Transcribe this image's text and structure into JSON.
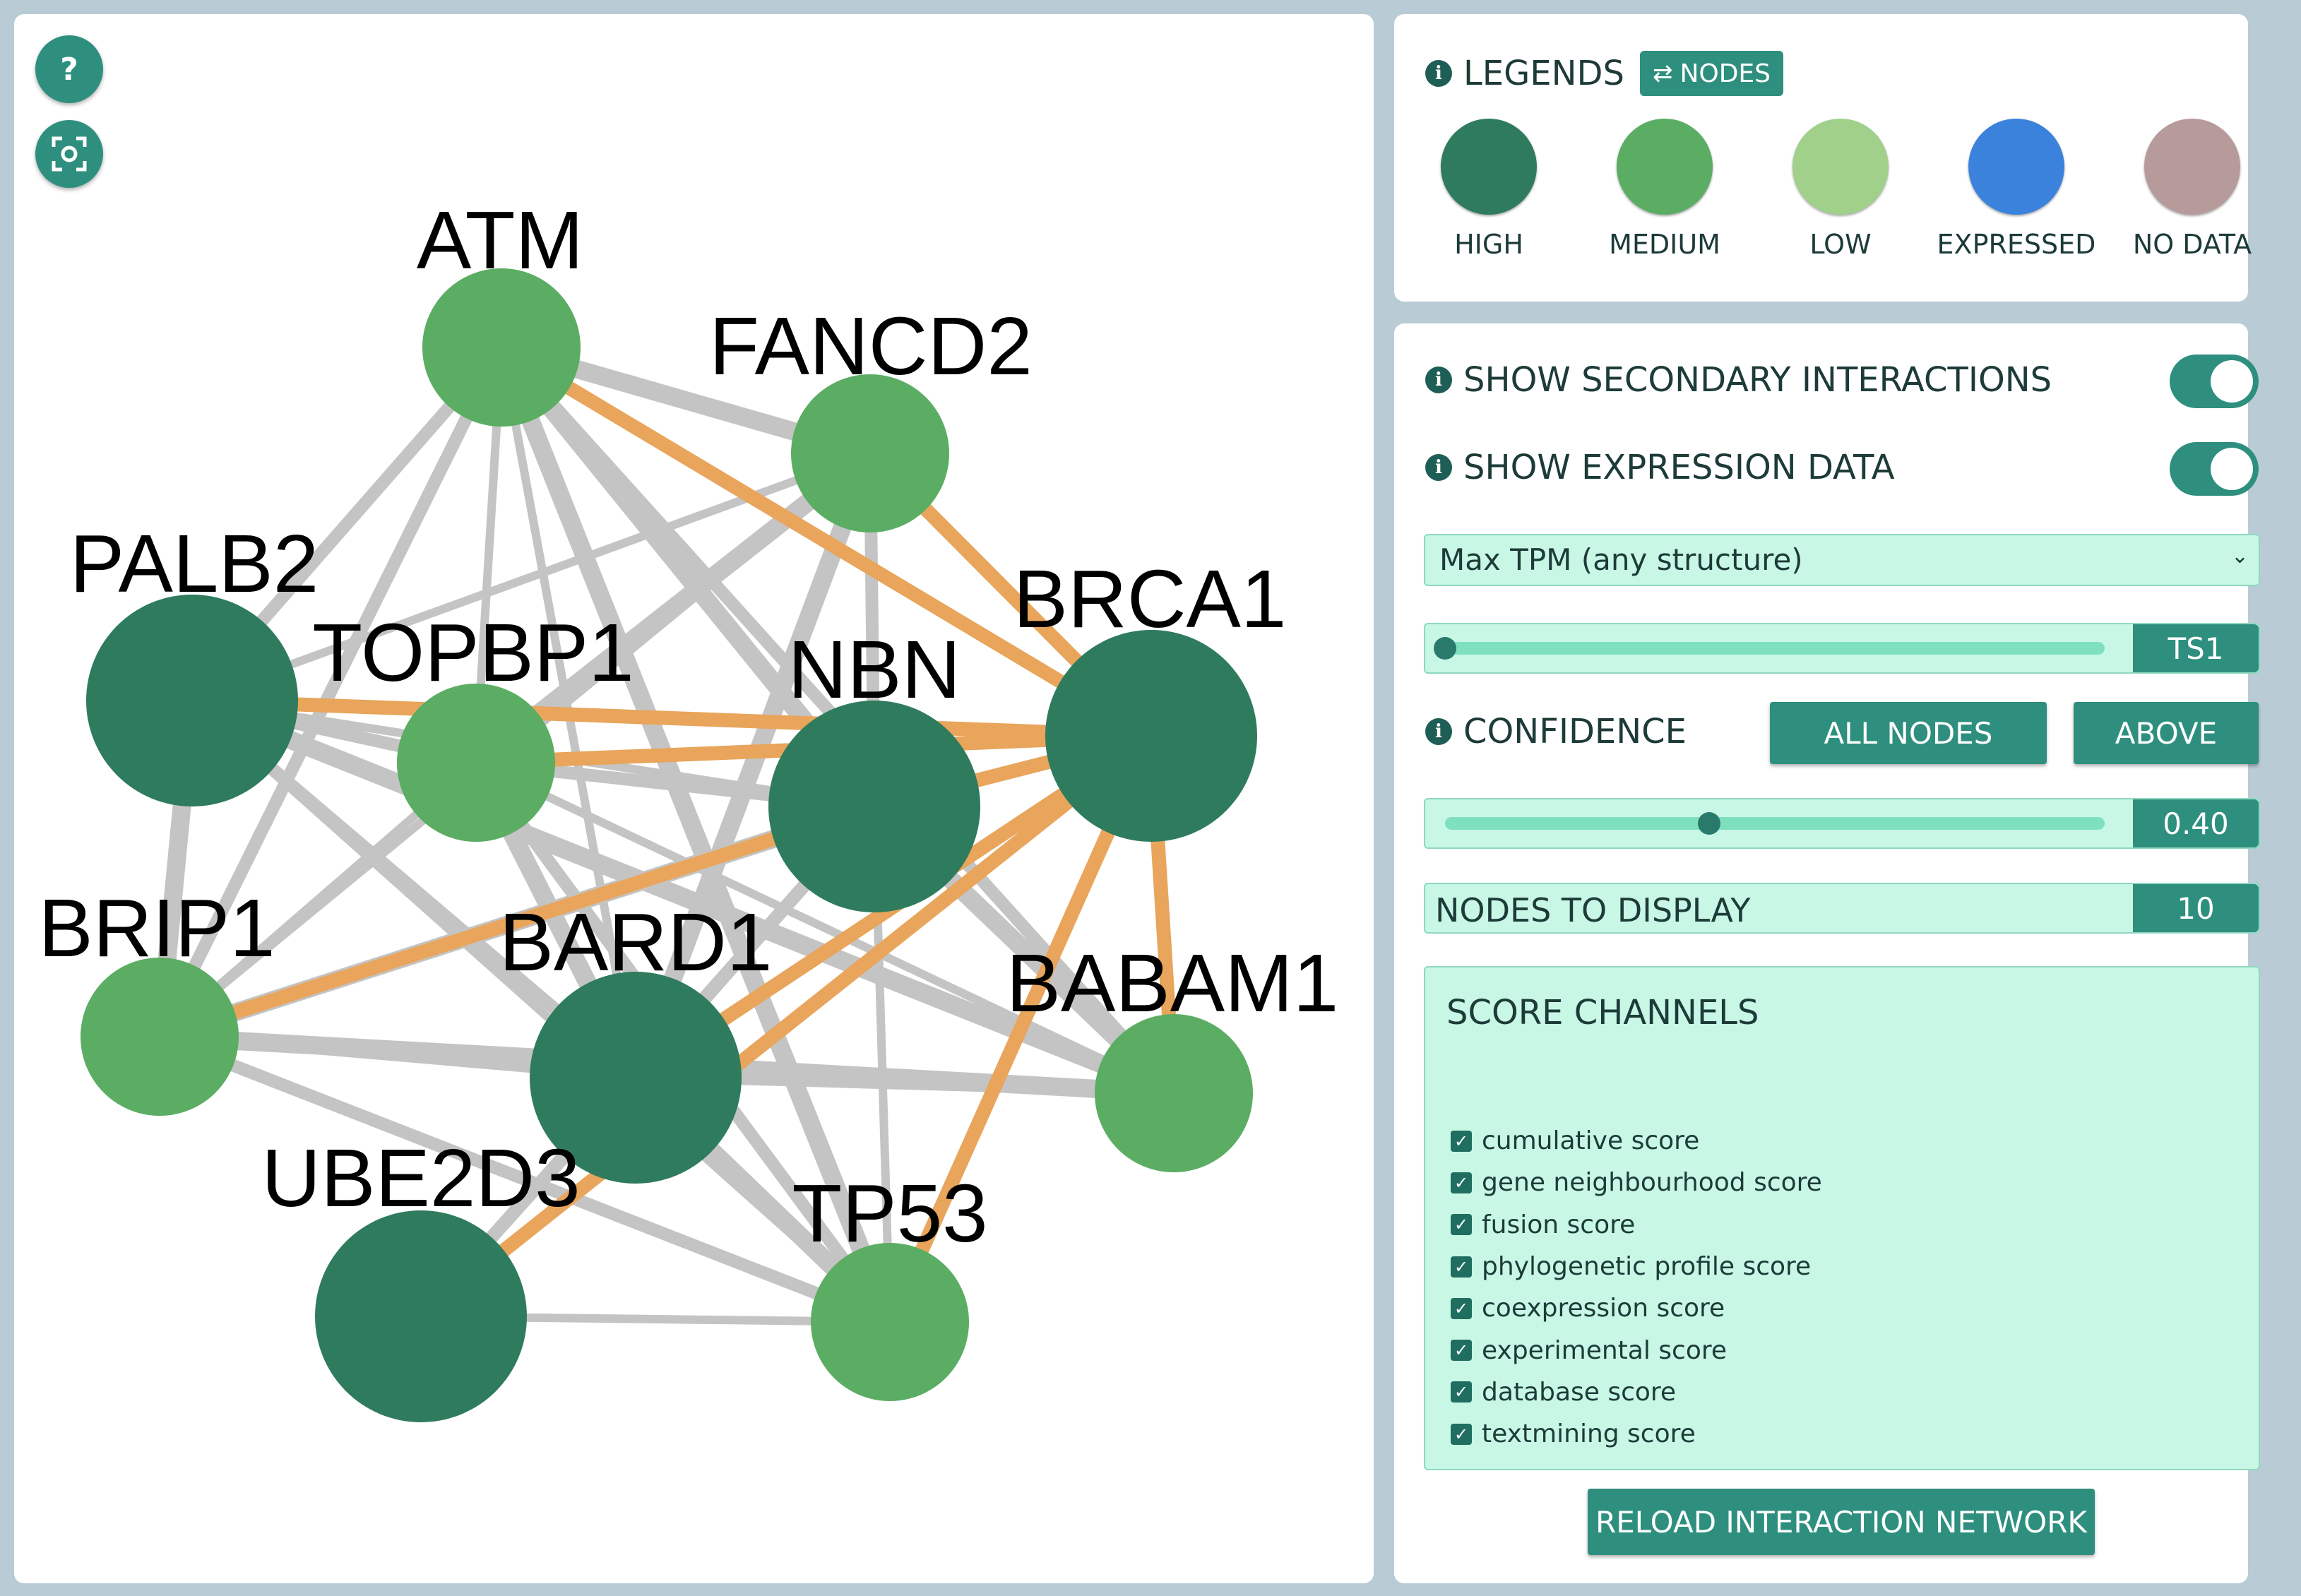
{
  "graph": {
    "help_label": "?",
    "nodes": [
      {
        "label": "ATM",
        "level": "medium"
      },
      {
        "label": "FANCD2",
        "level": "medium"
      },
      {
        "label": "PALB2",
        "level": "high"
      },
      {
        "label": "TOPBP1",
        "level": "medium"
      },
      {
        "label": "NBN",
        "level": "high"
      },
      {
        "label": "BRCA1",
        "level": "high"
      },
      {
        "label": "BRIP1",
        "level": "medium"
      },
      {
        "label": "BARD1",
        "level": "high"
      },
      {
        "label": "BABAM1",
        "level": "medium"
      },
      {
        "label": "UBE2D3",
        "level": "high"
      },
      {
        "label": "TP53",
        "level": "medium"
      }
    ],
    "edges": [
      {
        "source": "ATM",
        "target": "FANCD2",
        "color": "gray"
      },
      {
        "source": "ATM",
        "target": "BRCA1",
        "color": "orange"
      },
      {
        "source": "ATM",
        "target": "PALB2",
        "color": "gray"
      },
      {
        "source": "ATM",
        "target": "TOPBP1",
        "color": "gray"
      },
      {
        "source": "ATM",
        "target": "NBN",
        "color": "gray"
      },
      {
        "source": "ATM",
        "target": "BRIP1",
        "color": "gray"
      },
      {
        "source": "ATM",
        "target": "BARD1",
        "color": "gray"
      },
      {
        "source": "ATM",
        "target": "TP53",
        "color": "gray"
      },
      {
        "source": "ATM",
        "target": "BABAM1",
        "color": "gray"
      },
      {
        "source": "FANCD2",
        "target": "BRCA1",
        "color": "orange"
      },
      {
        "source": "FANCD2",
        "target": "PALB2",
        "color": "gray"
      },
      {
        "source": "FANCD2",
        "target": "TOPBP1",
        "color": "gray"
      },
      {
        "source": "FANCD2",
        "target": "NBN",
        "color": "gray"
      },
      {
        "source": "FANCD2",
        "target": "BRIP1",
        "color": "gray"
      },
      {
        "source": "FANCD2",
        "target": "BARD1",
        "color": "gray"
      },
      {
        "source": "PALB2",
        "target": "BRCA1",
        "color": "orange"
      },
      {
        "source": "PALB2",
        "target": "TOPBP1",
        "color": "gray"
      },
      {
        "source": "PALB2",
        "target": "NBN",
        "color": "gray"
      },
      {
        "source": "PALB2",
        "target": "BRIP1",
        "color": "gray"
      },
      {
        "source": "PALB2",
        "target": "BARD1",
        "color": "gray"
      },
      {
        "source": "PALB2",
        "target": "TP53",
        "color": "gray"
      },
      {
        "source": "PALB2",
        "target": "BABAM1",
        "color": "gray"
      },
      {
        "source": "TOPBP1",
        "target": "BRCA1",
        "color": "orange"
      },
      {
        "source": "TOPBP1",
        "target": "NBN",
        "color": "gray"
      },
      {
        "source": "TOPBP1",
        "target": "BRIP1",
        "color": "gray"
      },
      {
        "source": "TOPBP1",
        "target": "BARD1",
        "color": "gray"
      },
      {
        "source": "TOPBP1",
        "target": "TP53",
        "color": "gray"
      },
      {
        "source": "TOPBP1",
        "target": "BABAM1",
        "color": "gray"
      },
      {
        "source": "NBN",
        "target": "BRCA1",
        "color": "orange"
      },
      {
        "source": "NBN",
        "target": "BRIP1",
        "color": "gray"
      },
      {
        "source": "NBN",
        "target": "BARD1",
        "color": "gray"
      },
      {
        "source": "NBN",
        "target": "TP53",
        "color": "gray"
      },
      {
        "source": "NBN",
        "target": "BABAM1",
        "color": "gray"
      },
      {
        "source": "NBN",
        "target": "UBE2D3",
        "color": "gray"
      },
      {
        "source": "BRCA1",
        "target": "BARD1",
        "color": "orange"
      },
      {
        "source": "BRCA1",
        "target": "BABAM1",
        "color": "orange"
      },
      {
        "source": "BRCA1",
        "target": "TP53",
        "color": "orange"
      },
      {
        "source": "BRCA1",
        "target": "UBE2D3",
        "color": "orange"
      },
      {
        "source": "BRIP1",
        "target": "NBN",
        "color": "orange"
      },
      {
        "source": "BRIP1",
        "target": "BARD1",
        "color": "gray"
      },
      {
        "source": "BRIP1",
        "target": "BABAM1",
        "color": "gray"
      },
      {
        "source": "BRIP1",
        "target": "TP53",
        "color": "gray"
      },
      {
        "source": "BARD1",
        "target": "BABAM1",
        "color": "gray"
      },
      {
        "source": "BARD1",
        "target": "TP53",
        "color": "gray"
      },
      {
        "source": "BARD1",
        "target": "UBE2D3",
        "color": "gray"
      },
      {
        "source": "UBE2D3",
        "target": "TP53",
        "color": "gray"
      }
    ]
  },
  "legend": {
    "title": "LEGENDS",
    "toggle_label": "NODES",
    "items": [
      {
        "label": "HIGH",
        "color": "#2f7b5e"
      },
      {
        "label": "MEDIUM",
        "color": "#5bad63"
      },
      {
        "label": "LOW",
        "color": "#a1d08b"
      },
      {
        "label": "EXPRESSED",
        "color": "#3a82dc"
      },
      {
        "label": "NO DATA",
        "color": "#b79b9b"
      }
    ]
  },
  "controls": {
    "secondary_label": "SHOW SECONDARY INTERACTIONS",
    "secondary_on": true,
    "expression_label": "SHOW EXPRESSION DATA",
    "expression_on": true,
    "tpm_selected": "Max TPM (any structure)",
    "stage_value": "TS1",
    "stage_fraction": 0.0,
    "confidence_label": "CONFIDENCE",
    "all_nodes_label": "ALL NODES",
    "above_label": "ABOVE",
    "confidence_value": "0.40",
    "confidence_fraction": 0.4,
    "nodes_label": "NODES TO DISPLAY",
    "nodes_value": "10",
    "score_title": "SCORE CHANNELS",
    "score_channels": [
      "cumulative score",
      "gene neighbourhood score",
      "fusion score",
      "phylogenetic profile score",
      "coexpression score",
      "experimental score",
      "database score",
      "textmining score"
    ],
    "reload_label": "RELOAD INTERACTION NETWORK"
  },
  "colors": {
    "accent": "#2e8f7e",
    "mint": "#c8f7e6",
    "edge_gray": "#c4c4c4",
    "edge_orange": "#e8a55b",
    "high": "#2f7b5e",
    "medium": "#5bad63"
  }
}
